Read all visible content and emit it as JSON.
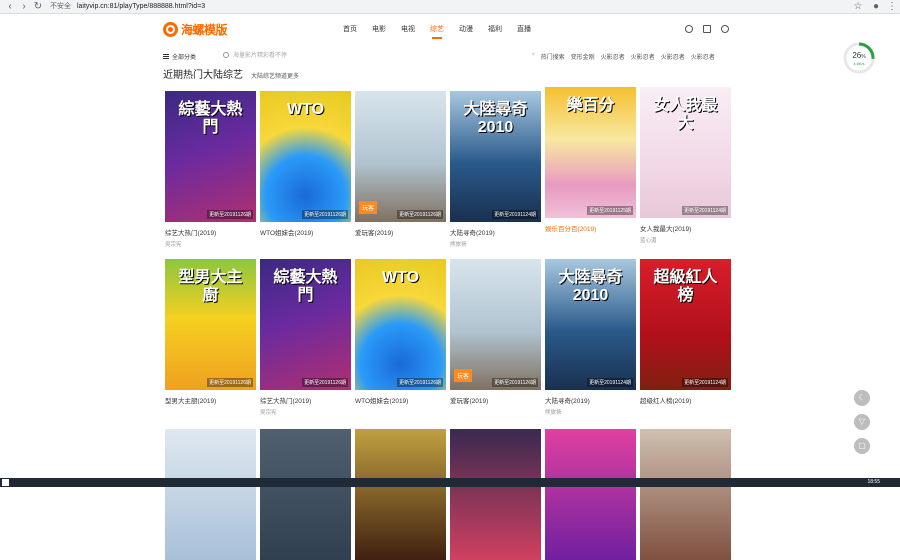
{
  "browser": {
    "security": "不安全",
    "url": "laityvip.cn:81/playType/888888.html?id=3"
  },
  "header": {
    "logo": "海螺模版",
    "nav": [
      "首页",
      "电影",
      "电视",
      "综艺",
      "动漫",
      "福利",
      "直播"
    ],
    "active_nav": "综艺"
  },
  "subbar": {
    "all_categories": "全部分类",
    "search_placeholder": "海量影片精彩看不停",
    "hot_label": "热门搜索",
    "hot_items": [
      "变形金刚",
      "火影忍者",
      "火影忍者",
      "火影忍者",
      "火影忍者"
    ]
  },
  "section": {
    "title": "近期热门大陆综艺",
    "more": "大陆综艺频道更多"
  },
  "row1": [
    {
      "title": "综艺大热门(2019)",
      "sub": "吴宗宪",
      "update": "更新至20191126期",
      "art": "綜藝大熱門",
      "cls": "p1"
    },
    {
      "title": "WTO姐妹会(2019)",
      "sub": "",
      "update": "更新至20191126期",
      "art": "WTO",
      "cls": "p2"
    },
    {
      "title": "爱玩客(2019)",
      "sub": "",
      "update": "更新至20191126期",
      "art": "",
      "cls": "p3",
      "badge": "玩客"
    },
    {
      "title": "大陆寻奇(2019)",
      "sub": "熊旅扬",
      "update": "更新至20191124期",
      "art": "大陸尋奇 2010",
      "cls": "p4"
    },
    {
      "title": "娱乐百分百(2019)",
      "sub": "",
      "update": "更新至20191125期",
      "art": "樂百分",
      "cls": "p5",
      "orange": true,
      "raised": true
    },
    {
      "title": "女人我最大(2019)",
      "sub": "蓝心湄",
      "update": "更新至20191124期",
      "art": "女人我最大",
      "cls": "p6",
      "raised": true
    }
  ],
  "row2": [
    {
      "title": "型男大主厨(2019)",
      "sub": "",
      "update": "更新至20191126期",
      "art": "型男大主廚",
      "cls": "p7"
    },
    {
      "title": "综艺大热门(2019)",
      "sub": "吴宗宪",
      "update": "更新至20191126期",
      "art": "綜藝大熱門",
      "cls": "p1"
    },
    {
      "title": "WTO姐妹会(2019)",
      "sub": "",
      "update": "更新至20191126期",
      "art": "WTO",
      "cls": "p2"
    },
    {
      "title": "爱玩客(2019)",
      "sub": "",
      "update": "更新至20191126期",
      "art": "",
      "cls": "p3",
      "badge": "玩客"
    },
    {
      "title": "大陆寻奇(2019)",
      "sub": "熊旅扬",
      "update": "更新至20191124期",
      "art": "大陸尋奇 2010",
      "cls": "p4"
    },
    {
      "title": "超级红人榜(2019)",
      "sub": "",
      "update": "更新至20191124期",
      "art": "超級紅人榜",
      "cls": "p8"
    }
  ],
  "row3": [
    {
      "cls": "p9"
    },
    {
      "cls": "p10"
    },
    {
      "cls": "p11"
    },
    {
      "cls": "p12"
    },
    {
      "cls": "p13"
    },
    {
      "cls": "p14"
    }
  ],
  "progress": {
    "value": "26",
    "unit": "%",
    "rate": "4.6K/s",
    "fraction": 0.26
  },
  "taskbar": {
    "clock": "18:55"
  }
}
